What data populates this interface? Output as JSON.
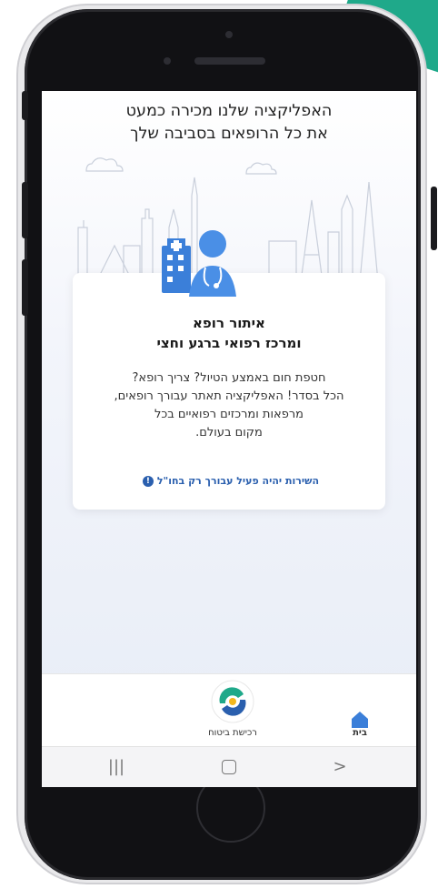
{
  "headline": {
    "line1": "האפליקציה שלנו מכירה כמעט",
    "line2": "את כל הרופאים בסביבה שלך"
  },
  "card": {
    "title_line1": "איתור רופא",
    "title_line2": "ומרכז רפואי ברגע וחצי",
    "body_line1": "חטפת חום באמצע הטיול? צריך רופא?",
    "body_line2": "הכל בסדר! האפליקציה תאתר עבורך רופאים,",
    "body_line3": "מרפאות ומרכזים רפואיים בכל",
    "body_line4": "מקום בעולם.",
    "note": "השירות יהיה פעיל עבורך רק בחו\"ל",
    "note_icon": "info-icon"
  },
  "tabbar": {
    "home_label": "בית",
    "home_icon": "home-icon",
    "purchase_label": "רכישת ביטוח",
    "purchase_icon": "app-logo-icon"
  },
  "navbar": {
    "recents_icon": "recent-apps-icon",
    "home_icon": "home-circle-icon",
    "back_icon": "back-chevron-icon"
  },
  "colors": {
    "accent": "#2a5fae",
    "corner_teal": "#1fa98a",
    "home_tab_blue": "#3b7fd9"
  }
}
